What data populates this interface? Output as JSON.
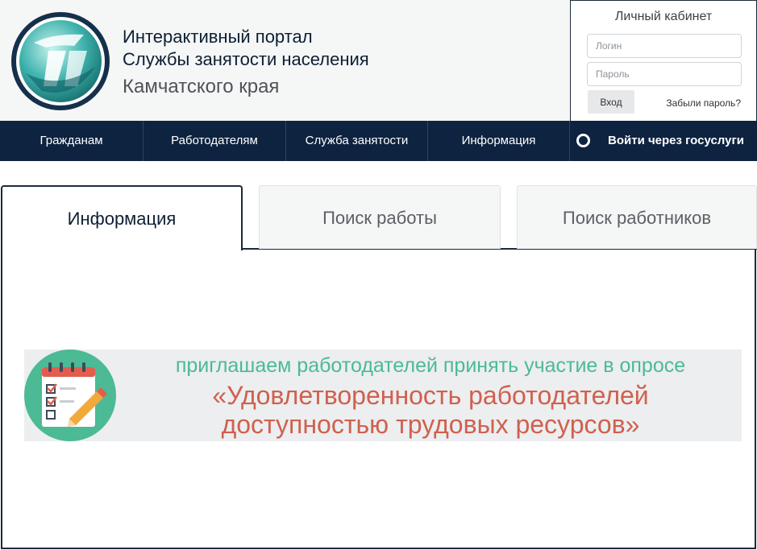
{
  "header": {
    "title_line1": "Интерактивный портал",
    "title_line2": "Службы занятости населения",
    "title_line3": "Камчатского края",
    "logo_icon": "portal-logo-icon"
  },
  "login": {
    "title": "Личный кабинет",
    "login_placeholder": "Логин",
    "login_value": "",
    "password_placeholder": "Пароль",
    "password_value": "",
    "submit_label": "Вход",
    "forgot_label": "Забыли пароль?"
  },
  "nav": {
    "items": [
      {
        "label": "Гражданам"
      },
      {
        "label": "Работодателям"
      },
      {
        "label": "Служба занятости"
      },
      {
        "label": "Информация"
      }
    ],
    "gosuslugi_label": "Войти через госуслуги",
    "gosuslugi_icon": "circle-icon"
  },
  "tabs": {
    "items": [
      {
        "label": "Информация",
        "active": true
      },
      {
        "label": "Поиск работы",
        "active": false
      },
      {
        "label": "Поиск работников",
        "active": false
      }
    ]
  },
  "banner": {
    "line1": "приглашаем работодателей принять участие в опросе",
    "line2": "«Удовлетворенность работодателей",
    "line3": "доступностью трудовых ресурсов»",
    "icon": "checklist-pencil-icon"
  },
  "colors": {
    "nav_bg": "#0d2340",
    "header_bg": "#f5f6f6",
    "banner_green": "#4cba94",
    "banner_red": "#d0604f",
    "border_dark": "#1b2a3b"
  }
}
